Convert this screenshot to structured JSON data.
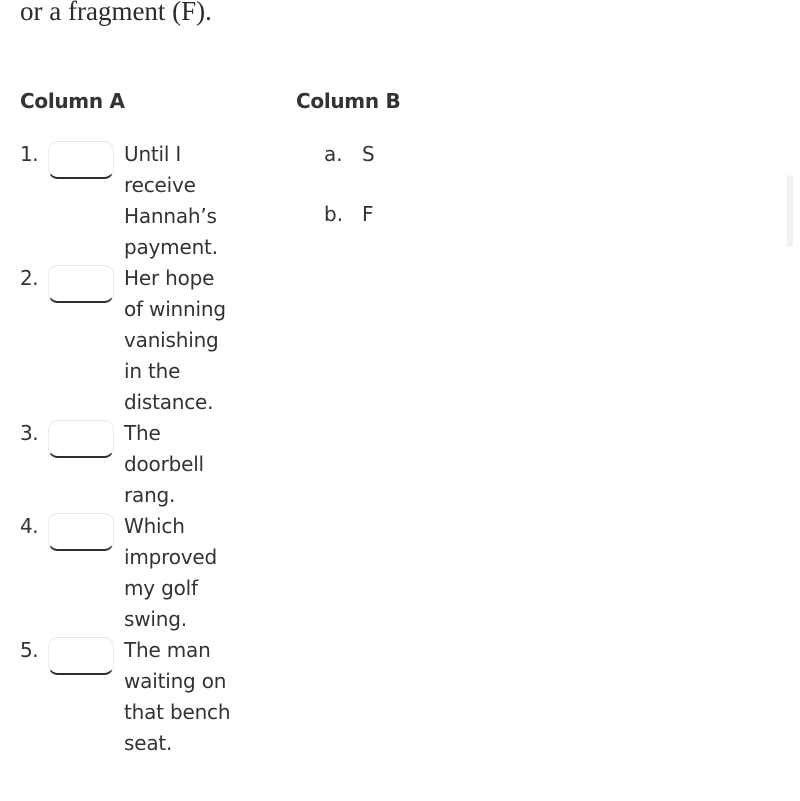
{
  "intro_text": "or a fragment (F).",
  "column_a": {
    "header": "Column A",
    "items": [
      {
        "number": "1.",
        "answer": "",
        "text": "Until I receive Hannah’s payment."
      },
      {
        "number": "2.",
        "answer": "",
        "text": "Her hope of winning vanishing in the distance."
      },
      {
        "number": "3.",
        "answer": "",
        "text": "The doorbell rang."
      },
      {
        "number": "4.",
        "answer": "",
        "text": "Which improved my golf swing."
      },
      {
        "number": "5.",
        "answer": "",
        "text": "The man waiting on that bench seat."
      }
    ]
  },
  "column_b": {
    "header": "Column B",
    "options": [
      {
        "letter": "a.",
        "label": "S"
      },
      {
        "letter": "b.",
        "label": "F"
      }
    ]
  }
}
